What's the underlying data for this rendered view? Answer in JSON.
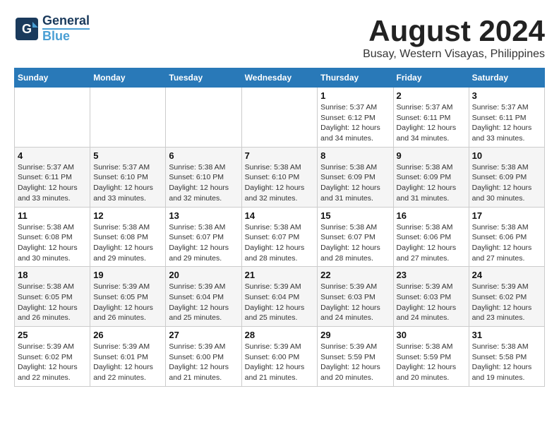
{
  "logo": {
    "line1": "General",
    "line2": "Blue"
  },
  "title": "August 2024",
  "subtitle": "Busay, Western Visayas, Philippines",
  "days_of_week": [
    "Sunday",
    "Monday",
    "Tuesday",
    "Wednesday",
    "Thursday",
    "Friday",
    "Saturday"
  ],
  "weeks": [
    [
      {
        "day": "",
        "info": ""
      },
      {
        "day": "",
        "info": ""
      },
      {
        "day": "",
        "info": ""
      },
      {
        "day": "",
        "info": ""
      },
      {
        "day": "1",
        "info": "Sunrise: 5:37 AM\nSunset: 6:12 PM\nDaylight: 12 hours\nand 34 minutes."
      },
      {
        "day": "2",
        "info": "Sunrise: 5:37 AM\nSunset: 6:11 PM\nDaylight: 12 hours\nand 34 minutes."
      },
      {
        "day": "3",
        "info": "Sunrise: 5:37 AM\nSunset: 6:11 PM\nDaylight: 12 hours\nand 33 minutes."
      }
    ],
    [
      {
        "day": "4",
        "info": "Sunrise: 5:37 AM\nSunset: 6:11 PM\nDaylight: 12 hours\nand 33 minutes."
      },
      {
        "day": "5",
        "info": "Sunrise: 5:37 AM\nSunset: 6:10 PM\nDaylight: 12 hours\nand 33 minutes."
      },
      {
        "day": "6",
        "info": "Sunrise: 5:38 AM\nSunset: 6:10 PM\nDaylight: 12 hours\nand 32 minutes."
      },
      {
        "day": "7",
        "info": "Sunrise: 5:38 AM\nSunset: 6:10 PM\nDaylight: 12 hours\nand 32 minutes."
      },
      {
        "day": "8",
        "info": "Sunrise: 5:38 AM\nSunset: 6:09 PM\nDaylight: 12 hours\nand 31 minutes."
      },
      {
        "day": "9",
        "info": "Sunrise: 5:38 AM\nSunset: 6:09 PM\nDaylight: 12 hours\nand 31 minutes."
      },
      {
        "day": "10",
        "info": "Sunrise: 5:38 AM\nSunset: 6:09 PM\nDaylight: 12 hours\nand 30 minutes."
      }
    ],
    [
      {
        "day": "11",
        "info": "Sunrise: 5:38 AM\nSunset: 6:08 PM\nDaylight: 12 hours\nand 30 minutes."
      },
      {
        "day": "12",
        "info": "Sunrise: 5:38 AM\nSunset: 6:08 PM\nDaylight: 12 hours\nand 29 minutes."
      },
      {
        "day": "13",
        "info": "Sunrise: 5:38 AM\nSunset: 6:07 PM\nDaylight: 12 hours\nand 29 minutes."
      },
      {
        "day": "14",
        "info": "Sunrise: 5:38 AM\nSunset: 6:07 PM\nDaylight: 12 hours\nand 28 minutes."
      },
      {
        "day": "15",
        "info": "Sunrise: 5:38 AM\nSunset: 6:07 PM\nDaylight: 12 hours\nand 28 minutes."
      },
      {
        "day": "16",
        "info": "Sunrise: 5:38 AM\nSunset: 6:06 PM\nDaylight: 12 hours\nand 27 minutes."
      },
      {
        "day": "17",
        "info": "Sunrise: 5:38 AM\nSunset: 6:06 PM\nDaylight: 12 hours\nand 27 minutes."
      }
    ],
    [
      {
        "day": "18",
        "info": "Sunrise: 5:38 AM\nSunset: 6:05 PM\nDaylight: 12 hours\nand 26 minutes."
      },
      {
        "day": "19",
        "info": "Sunrise: 5:39 AM\nSunset: 6:05 PM\nDaylight: 12 hours\nand 26 minutes."
      },
      {
        "day": "20",
        "info": "Sunrise: 5:39 AM\nSunset: 6:04 PM\nDaylight: 12 hours\nand 25 minutes."
      },
      {
        "day": "21",
        "info": "Sunrise: 5:39 AM\nSunset: 6:04 PM\nDaylight: 12 hours\nand 25 minutes."
      },
      {
        "day": "22",
        "info": "Sunrise: 5:39 AM\nSunset: 6:03 PM\nDaylight: 12 hours\nand 24 minutes."
      },
      {
        "day": "23",
        "info": "Sunrise: 5:39 AM\nSunset: 6:03 PM\nDaylight: 12 hours\nand 24 minutes."
      },
      {
        "day": "24",
        "info": "Sunrise: 5:39 AM\nSunset: 6:02 PM\nDaylight: 12 hours\nand 23 minutes."
      }
    ],
    [
      {
        "day": "25",
        "info": "Sunrise: 5:39 AM\nSunset: 6:02 PM\nDaylight: 12 hours\nand 22 minutes."
      },
      {
        "day": "26",
        "info": "Sunrise: 5:39 AM\nSunset: 6:01 PM\nDaylight: 12 hours\nand 22 minutes."
      },
      {
        "day": "27",
        "info": "Sunrise: 5:39 AM\nSunset: 6:00 PM\nDaylight: 12 hours\nand 21 minutes."
      },
      {
        "day": "28",
        "info": "Sunrise: 5:39 AM\nSunset: 6:00 PM\nDaylight: 12 hours\nand 21 minutes."
      },
      {
        "day": "29",
        "info": "Sunrise: 5:39 AM\nSunset: 5:59 PM\nDaylight: 12 hours\nand 20 minutes."
      },
      {
        "day": "30",
        "info": "Sunrise: 5:38 AM\nSunset: 5:59 PM\nDaylight: 12 hours\nand 20 minutes."
      },
      {
        "day": "31",
        "info": "Sunrise: 5:38 AM\nSunset: 5:58 PM\nDaylight: 12 hours\nand 19 minutes."
      }
    ]
  ]
}
